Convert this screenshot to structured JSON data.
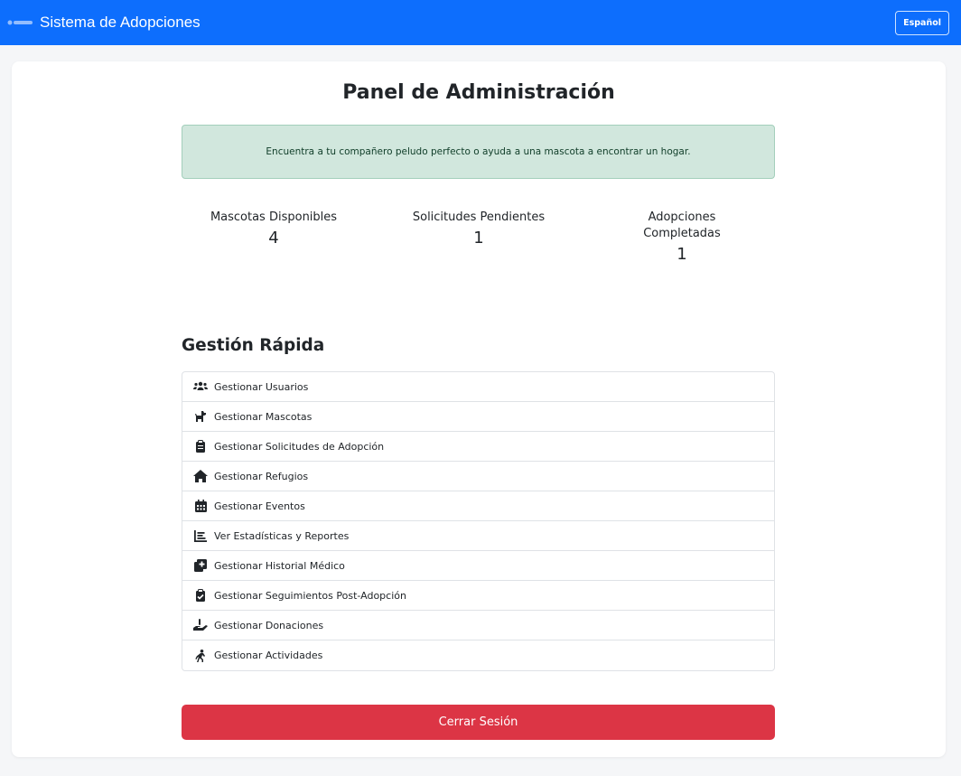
{
  "navbar": {
    "title": "Sistema de Adopciones",
    "language": "Español",
    "brand_color": "#0d6efd"
  },
  "page": {
    "title": "Panel de Administración",
    "alert": "Encuentra a tu compañero peludo perfecto o ayuda a una mascota a encontrar un hogar.",
    "alert_color": "#d1e7dd"
  },
  "stats": [
    {
      "label": "Mascotas Disponibles",
      "value": "4"
    },
    {
      "label": "Solicitudes Pendientes",
      "value": "1"
    },
    {
      "label": "Adopciones Completadas",
      "value": "1"
    }
  ],
  "quick": {
    "title": "Gestión Rápida",
    "items": [
      {
        "label": "Gestionar Usuarios",
        "icon": "users-icon"
      },
      {
        "label": "Gestionar Mascotas",
        "icon": "dog-icon"
      },
      {
        "label": "Gestionar Solicitudes de Adopción",
        "icon": "clipboard-icon"
      },
      {
        "label": "Gestionar Refugios",
        "icon": "home-icon"
      },
      {
        "label": "Gestionar Eventos",
        "icon": "calendar-icon"
      },
      {
        "label": "Ver Estadísticas y Reportes",
        "icon": "chart-icon"
      },
      {
        "label": "Gestionar Historial Médico",
        "icon": "medical-file-icon"
      },
      {
        "label": "Gestionar Seguimientos Post-Adopción",
        "icon": "clipboard-check-icon"
      },
      {
        "label": "Gestionar Donaciones",
        "icon": "hand-holding-icon"
      },
      {
        "label": "Gestionar Actividades",
        "icon": "running-icon"
      }
    ]
  },
  "logout": {
    "label": "Cerrar Sesión",
    "color": "#dc3545"
  }
}
